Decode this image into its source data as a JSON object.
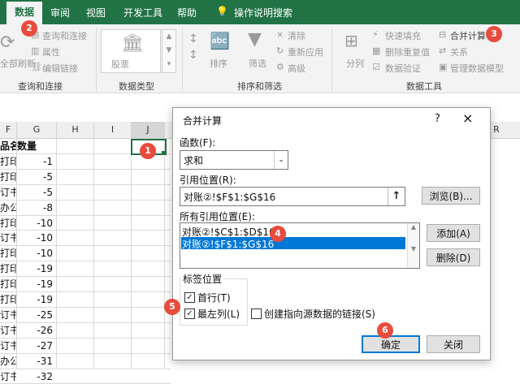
{
  "tabs": [
    "数据",
    "审阅",
    "视图",
    "开发工具",
    "帮助",
    "操作说明搜索"
  ],
  "ribbon": {
    "query_items": [
      "查询和连接",
      "属性",
      "编辑链接"
    ],
    "refresh_label": "全部刷新",
    "datatype_label": "股票",
    "sort_label": "排序",
    "filter_label": "筛选",
    "filter_items": [
      "清除",
      "重新应用",
      "高级"
    ],
    "split_label": "分列",
    "tools_items": [
      "快速填充",
      "删除重复值",
      "数据验证"
    ],
    "tools_items2": [
      "合并计算",
      "关系",
      "管理数据模型"
    ],
    "group_labels": [
      "查询和连接",
      "数据类型",
      "排序和筛选",
      "数据工具"
    ]
  },
  "sheet": {
    "columns": [
      "F",
      "G",
      "H",
      "I",
      "J",
      "R"
    ],
    "header_f": "品名",
    "header_g": "数量",
    "rows": [
      {
        "f": "打印机",
        "g": "-1"
      },
      {
        "f": "打印机",
        "g": "-5"
      },
      {
        "f": "订书机",
        "g": "-5"
      },
      {
        "f": "办公桌",
        "g": "-8"
      },
      {
        "f": "打印机",
        "g": "-10"
      },
      {
        "f": "订书机",
        "g": "-10"
      },
      {
        "f": "打印机",
        "g": "-10"
      },
      {
        "f": "打印机",
        "g": "-19"
      },
      {
        "f": "打印机",
        "g": "-19"
      },
      {
        "f": "打印机",
        "g": "-19"
      },
      {
        "f": "订书机",
        "g": "-25"
      },
      {
        "f": "订书机",
        "g": "-26"
      },
      {
        "f": "订书机",
        "g": "-27"
      },
      {
        "f": "办公桌",
        "g": "-31"
      },
      {
        "f": "订书机",
        "g": "-32"
      }
    ]
  },
  "dialog": {
    "title": "合并计算",
    "help": "?",
    "close": "×",
    "function_label": "函数(F):",
    "function_value": "求和",
    "ref_label": "引用位置(R):",
    "ref_value": "对账②!$F$1:$G$16",
    "browse": "浏览(B)...",
    "all_refs_label": "所有引用位置(E):",
    "all_refs": [
      "对账②!$C$1:$D$16",
      "对账②!$F$1:$G$16"
    ],
    "add": "添加(A)",
    "delete": "删除(D)",
    "label_pos": "标签位置",
    "first_row": "首行(T)",
    "left_col": "最左列(L)",
    "create_links": "创建指向源数据的链接(S)",
    "ok": "确定",
    "cancel": "关闭"
  },
  "badges": [
    "1",
    "2",
    "3",
    "4",
    "5",
    "6"
  ]
}
